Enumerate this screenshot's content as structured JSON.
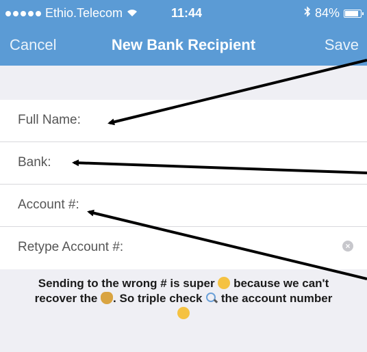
{
  "status_bar": {
    "carrier": "Ethio.Telecom",
    "time": "11:44",
    "battery": "84%"
  },
  "nav": {
    "cancel_label": "Cancel",
    "title": "New Bank Recipient",
    "save_label": "Save"
  },
  "form": {
    "fields": [
      {
        "label": "Full Name:"
      },
      {
        "label": "Bank:"
      },
      {
        "label": "Account #:"
      },
      {
        "label": "Retype Account #:"
      }
    ]
  },
  "note": {
    "part1": "Sending to the wrong # is super",
    "part2": "because we can't recover the",
    "part3": ". So triple check",
    "part4": "the account number"
  },
  "colors": {
    "nav_blue": "#5b9bd5",
    "annotation_arrow": "#000000"
  }
}
